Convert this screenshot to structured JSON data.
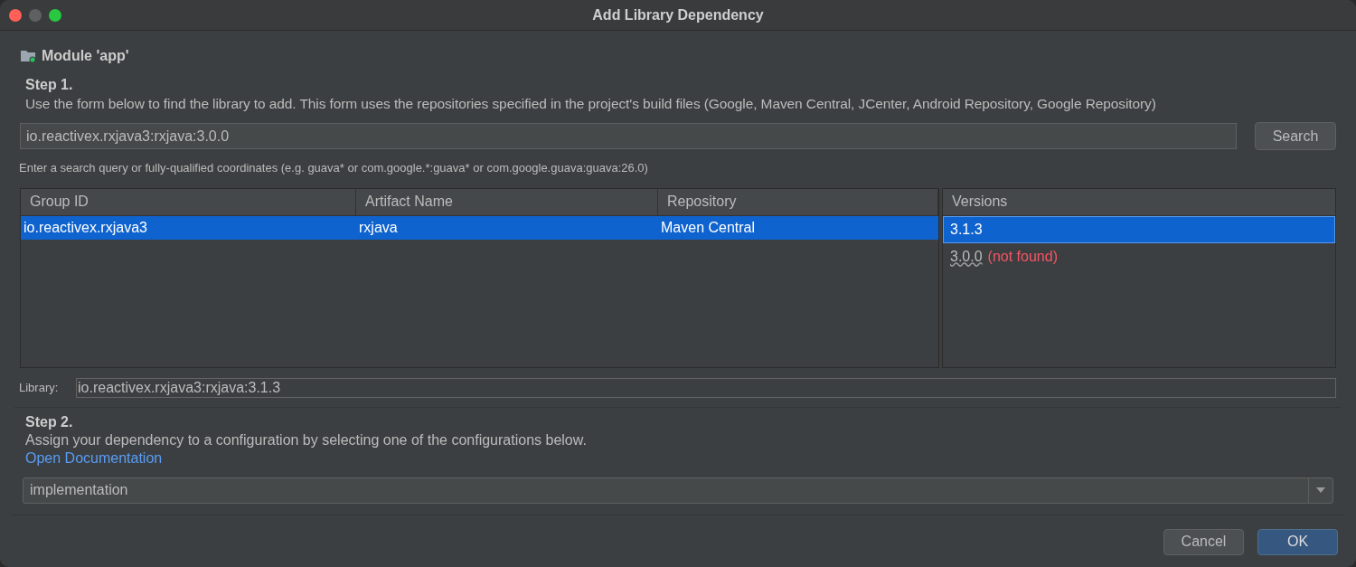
{
  "window": {
    "title": "Add Library Dependency"
  },
  "module": {
    "label": "Module 'app'"
  },
  "step1": {
    "title": "Step 1.",
    "description": "Use the form below to find the library to add. This form uses the repositories specified in the project's build files (Google, Maven Central, JCenter, Android Repository, Google Repository)"
  },
  "search": {
    "value": "io.reactivex.rxjava3:rxjava:3.0.0",
    "button": "Search",
    "hint": "Enter a search query or fully-qualified coordinates (e.g. guava* or com.google.*:guava* or com.google.guava:guava:26.0)"
  },
  "table": {
    "columns": [
      "Group ID",
      "Artifact Name",
      "Repository"
    ],
    "rows": [
      {
        "cells": [
          "io.reactivex.rxjava3",
          "rxjava",
          "Maven Central"
        ],
        "selected": true
      }
    ]
  },
  "versions": {
    "title": "Versions",
    "items": [
      {
        "label": "3.1.3",
        "selected": true
      },
      {
        "label": "3.0.0",
        "note": "(not found)",
        "selected": false
      }
    ]
  },
  "library": {
    "label": "Library:",
    "value": "io.reactivex.rxjava3:rxjava:3.1.3"
  },
  "step2": {
    "title": "Step 2.",
    "description": "Assign your dependency to a configuration by selecting one of the configurations below.",
    "link": "Open Documentation"
  },
  "configuration": {
    "value": "implementation"
  },
  "buttons": [
    {
      "label": "Cancel",
      "kind": "secondary"
    },
    {
      "label": "OK",
      "kind": "primary"
    }
  ]
}
